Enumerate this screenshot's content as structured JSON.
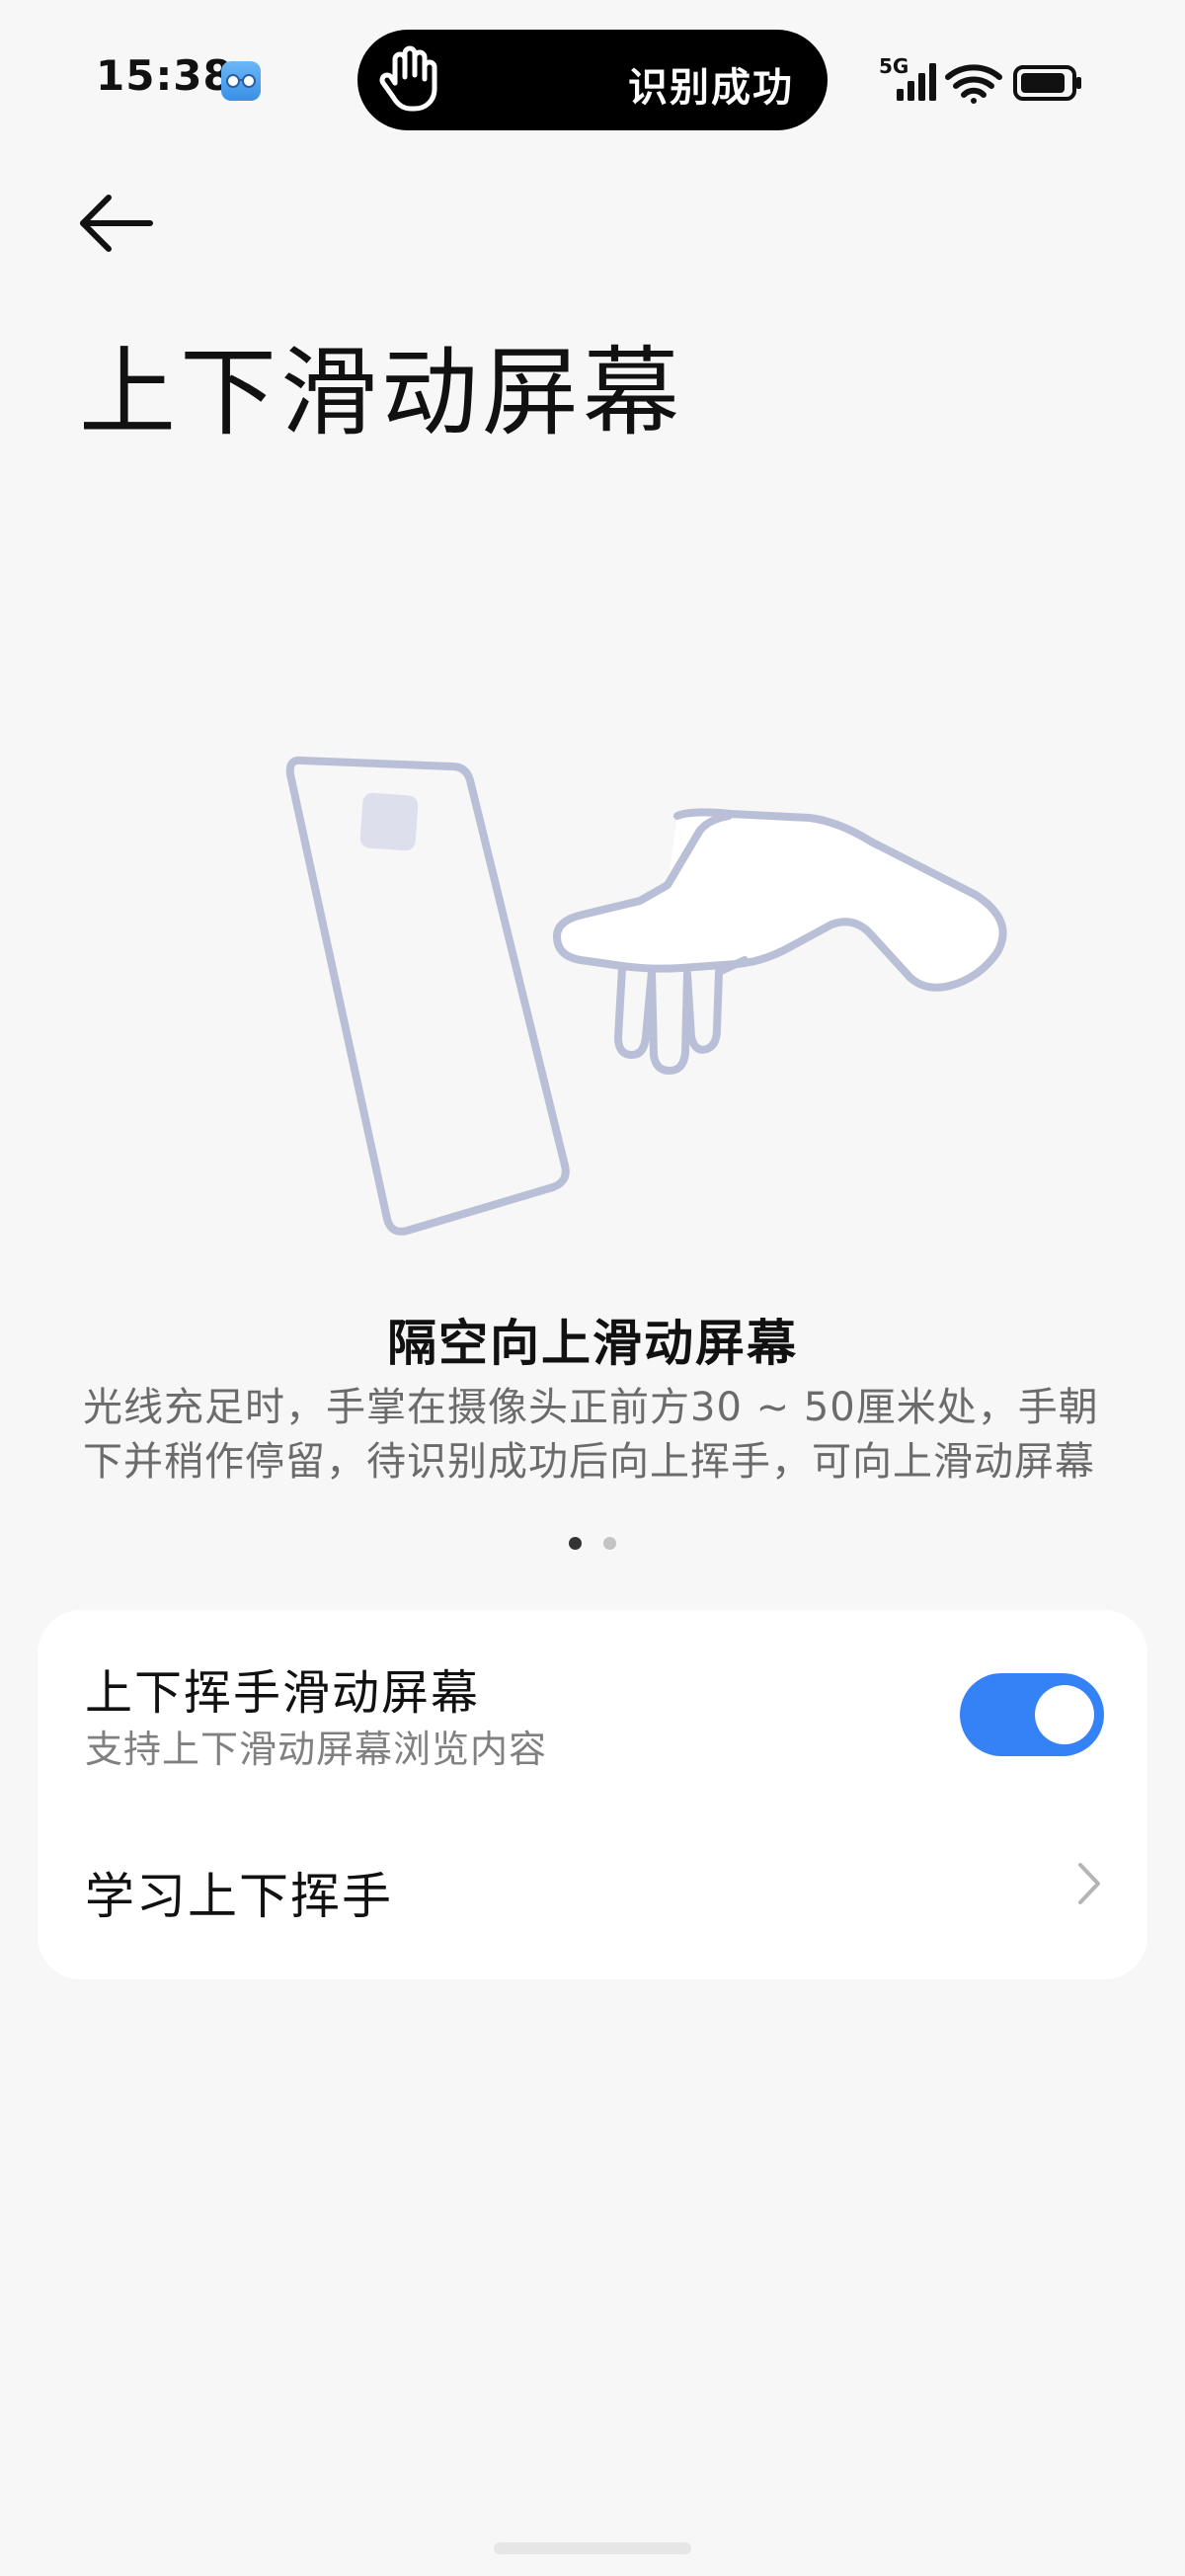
{
  "status_bar": {
    "time": "15:38",
    "app_icon": "glasses-app-icon",
    "island_text": "识别成功",
    "island_icon": "hand-icon",
    "network_label": "5G",
    "icons": [
      "signal-icon",
      "wifi-icon",
      "battery-icon"
    ]
  },
  "header": {
    "back_icon": "arrow-left-icon",
    "title": "上下滑动屏幕"
  },
  "illustration": {
    "depicts": [
      "phone-outline",
      "hand-outline"
    ],
    "stroke_color": "#b9bfd6"
  },
  "guide": {
    "title": "隔空向上滑动屏幕",
    "description": "光线充足时，手掌在摄像头正前方30 ~ 50厘米处，手朝下并稍作停留，待识别成功后向上挥手，可向上滑动屏幕",
    "page_count": 2,
    "current_page": 1
  },
  "settings": {
    "toggle_row": {
      "title": "上下挥手滑动屏幕",
      "subtitle": "支持上下滑动屏幕浏览内容",
      "enabled": true
    },
    "link_row": {
      "title": "学习上下挥手",
      "icon": "chevron-right-icon"
    }
  },
  "colors": {
    "accent": "#3482f6",
    "background": "#f7f7f7",
    "card": "#ffffff"
  }
}
